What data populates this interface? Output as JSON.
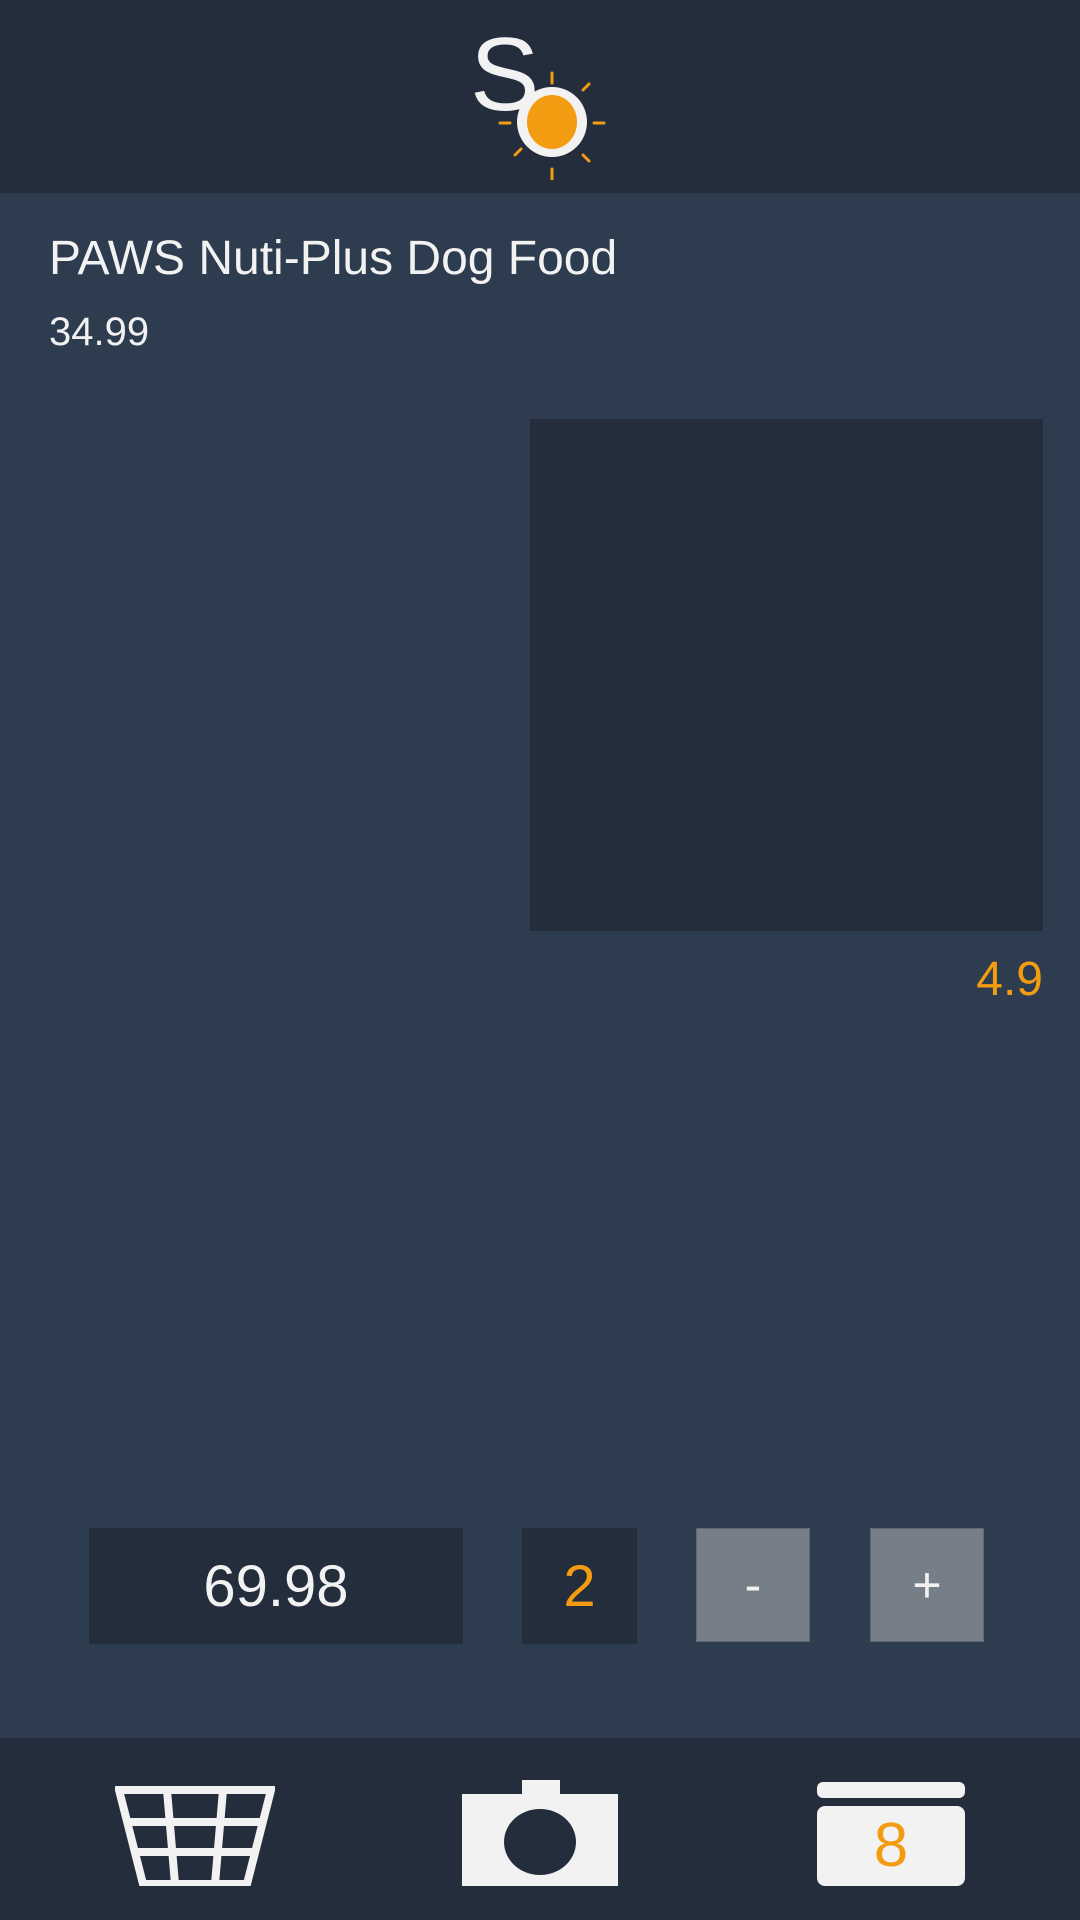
{
  "app": {
    "logo_icon": "sun-logo-icon",
    "accent_color": "#f39c12"
  },
  "product": {
    "name": "PAWS Nuti-Plus Dog Food",
    "price": "34.99",
    "rating": "4.9"
  },
  "order": {
    "total": "69.98",
    "quantity": "2",
    "decrease_label": "-",
    "increase_label": "+"
  },
  "bottom_nav": {
    "items": [
      {
        "icon": "basket-icon"
      },
      {
        "icon": "camera-icon"
      },
      {
        "icon": "cart-icon",
        "badge": "8"
      }
    ]
  }
}
